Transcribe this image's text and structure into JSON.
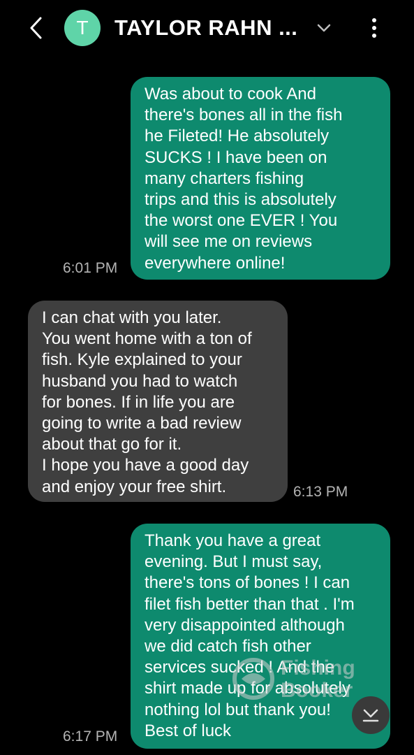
{
  "header": {
    "avatar_letter": "T",
    "contact_name": "TAYLOR RAHN ..."
  },
  "colors": {
    "sent_bubble": "#0e8a6e",
    "received_bubble": "#3f3f3f",
    "avatar": "#5fd4a8",
    "background": "#000000"
  },
  "messages": [
    {
      "direction": "sent",
      "time": "6:01 PM",
      "lines": [
        "Was about to cook And",
        "there's bones all in the fish",
        "he Fileted! He absolutely",
        "SUCKS ! I have been on",
        "many charters fishing",
        "trips and this is absolutely",
        "the worst one EVER ! You",
        "will see me on reviews",
        "everywhere online!"
      ]
    },
    {
      "direction": "received",
      "time": "6:13 PM",
      "lines": [
        "I can chat with you later.",
        "You went home with a ton of",
        "fish. Kyle explained to your",
        "husband you had to watch",
        "for bones. If in life you are",
        "going to write a bad review",
        "about that go for it.",
        "I hope you have a good day",
        "and enjoy your free shirt."
      ]
    },
    {
      "direction": "sent",
      "time": "6:17 PM",
      "lines": [
        "Thank you have a great",
        "evening.  But I must say,",
        "there's tons of bones ! I can",
        "filet fish better than that . I'm",
        "very disappointed although",
        "we did catch fish other",
        "services sucked ! And the",
        "shirt made up for absolutely",
        "nothing lol but thank you!",
        "Best of luck"
      ]
    }
  ],
  "watermark": {
    "line1": "Fishing",
    "line2": "Booker"
  },
  "icons": {
    "back": "back-arrow-icon",
    "expand": "chevron-down-icon",
    "more": "more-vertical-icon",
    "scroll": "scroll-to-bottom-icon"
  }
}
